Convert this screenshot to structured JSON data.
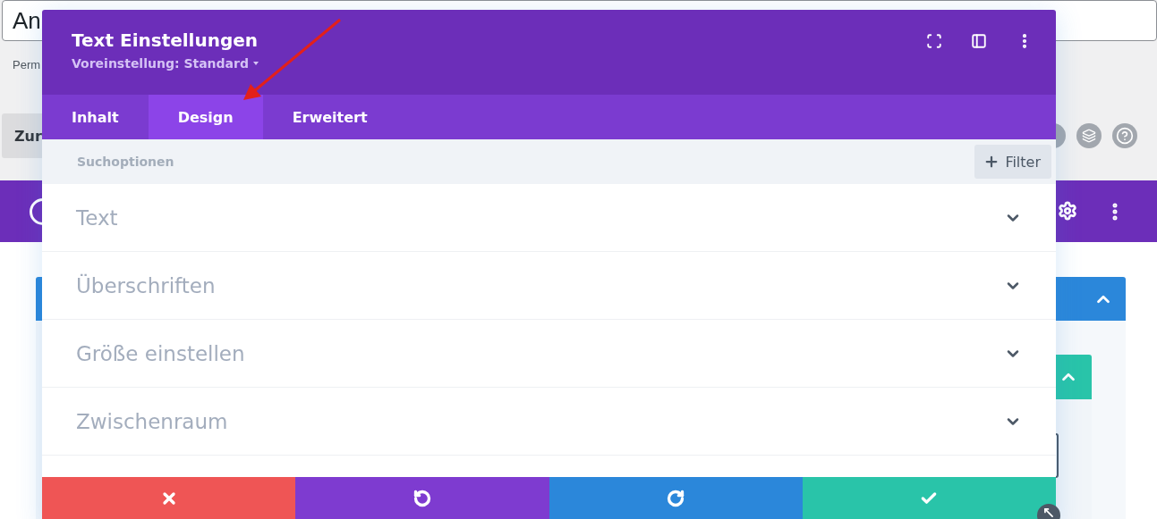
{
  "background": {
    "title_field": {
      "value": "An"
    },
    "permalink_label": "Perm",
    "toolbar_button": "Zur"
  },
  "modal": {
    "title": "Text Einstellungen",
    "preset": "Voreinstellung: Standard",
    "tabs": [
      {
        "label": "Inhalt",
        "selected": false
      },
      {
        "label": "Design",
        "selected": true
      },
      {
        "label": "Erweitert",
        "selected": false
      }
    ],
    "search": {
      "placeholder": "Suchoptionen"
    },
    "filter_button": "Filter",
    "sections": [
      {
        "label": "Text",
        "expanded": false
      },
      {
        "label": "Überschriften",
        "expanded": false
      },
      {
        "label": "Größe einstellen",
        "expanded": false
      },
      {
        "label": "Zwischenraum",
        "expanded": false
      }
    ],
    "actions": [
      {
        "kind": "cancel"
      },
      {
        "kind": "undo"
      },
      {
        "kind": "redo"
      },
      {
        "kind": "save"
      }
    ]
  }
}
